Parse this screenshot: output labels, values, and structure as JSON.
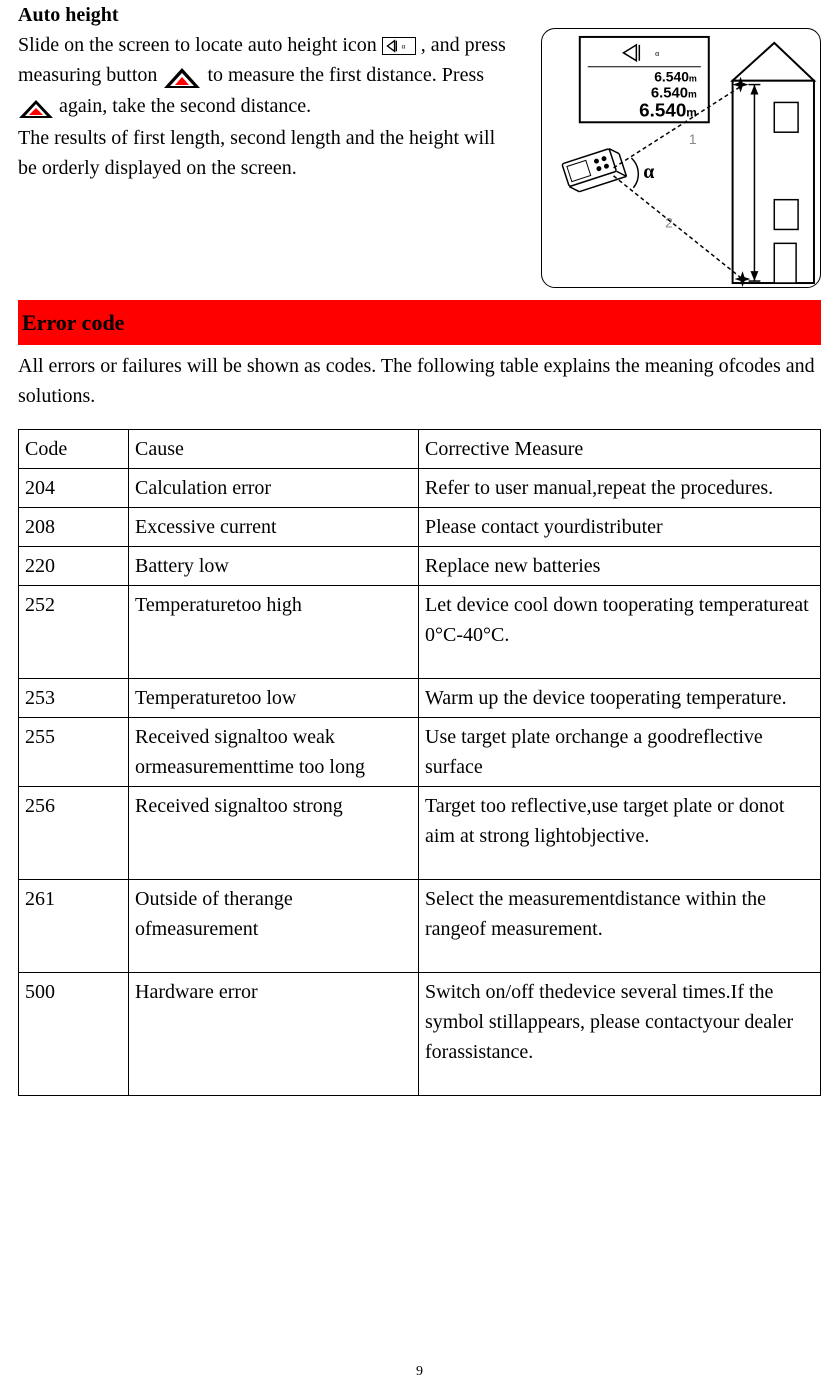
{
  "auto_height": {
    "title": "Auto height",
    "line1a": "Slide on the screen to locate auto height icon ",
    "line1b": " , and press measuring button ",
    "line1c": " to measure the first distance. Press ",
    "line1d": " again, take the second distance.",
    "line2": "The results of first length, second length and the height will be orderly displayed on the screen."
  },
  "diagram": {
    "val1": "6.540",
    "unit1": "m",
    "val2": "6.540",
    "unit2": "m",
    "val3": "6.540",
    "unit3": "m",
    "alpha": "α",
    "n1": "1",
    "n2": "2"
  },
  "error_section": {
    "title": "Error code",
    "intro": "All errors or failures will be shown as codes. The following table explains the meaning ofcodes and solutions."
  },
  "table": {
    "headers": {
      "code": "Code",
      "cause": "Cause",
      "measure": "Corrective Measure"
    },
    "rows": [
      {
        "code": "204",
        "cause": "Calculation error",
        "measure": "Refer to user manual,repeat the procedures."
      },
      {
        "code": "208",
        "cause": "Excessive current",
        "measure": "Please contact yourdistributer"
      },
      {
        "code": "220",
        "cause": "Battery low",
        "measure": "Replace new batteries"
      },
      {
        "code": "252",
        "cause": "Temperaturetoo high",
        "measure": "Let device cool down tooperating temperatureat 0°C-40°C.",
        "pad": true
      },
      {
        "code": "253",
        "cause": "Temperaturetoo low",
        "measure": "Warm up the device tooperating temperature."
      },
      {
        "code": "255",
        "cause": "Received signaltoo weak ormeasurementtime too long",
        "measure": "Use target plate orchange a goodreflective surface"
      },
      {
        "code": "256",
        "cause": "Received signaltoo strong",
        "measure": "Target too reflective,use target plate or donot aim at strong lightobjective.",
        "pad": true
      },
      {
        "code": "261",
        "cause": "Outside of therange ofmeasurement",
        "measure": "Select the measurementdistance within the rangeof measurement.",
        "pad": true
      },
      {
        "code": "500",
        "cause": "Hardware error",
        "measure": "Switch on/off thedevice several times.If the symbol stillappears, please contactyour dealer forassistance.",
        "pad": true
      }
    ]
  },
  "page_number": "9"
}
